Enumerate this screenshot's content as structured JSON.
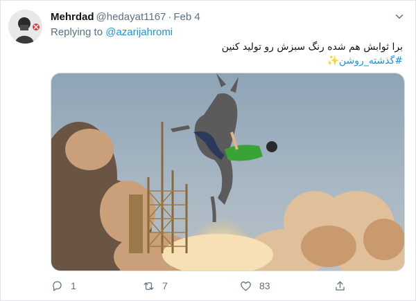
{
  "tweet": {
    "author": {
      "name": "Mehrdad",
      "handle": "@hedayat1167",
      "avatar_icon": "profile-photo"
    },
    "separator": "·",
    "date": "Feb 4",
    "replying_to": {
      "label": "Replying to",
      "mention": "@azarijahromi"
    },
    "text": "برا ثوابش هم شده رنگ سبزش رو تولید کنین",
    "hashtag": "#گذشته_روشن",
    "hashtag_emoji": "✨",
    "media": {
      "description_icon": "donkey-rocket-launch-image"
    },
    "actions": {
      "reply": {
        "icon": "reply-icon",
        "count": "1"
      },
      "retweet": {
        "icon": "retweet-icon",
        "count": "7"
      },
      "like": {
        "icon": "heart-icon",
        "count": "83"
      },
      "share": {
        "icon": "share-icon"
      }
    }
  },
  "colors": {
    "link": "#1b95e0",
    "secondary_text": "#5b7083",
    "primary_text": "#0f1419",
    "border": "#dfe3e7"
  }
}
